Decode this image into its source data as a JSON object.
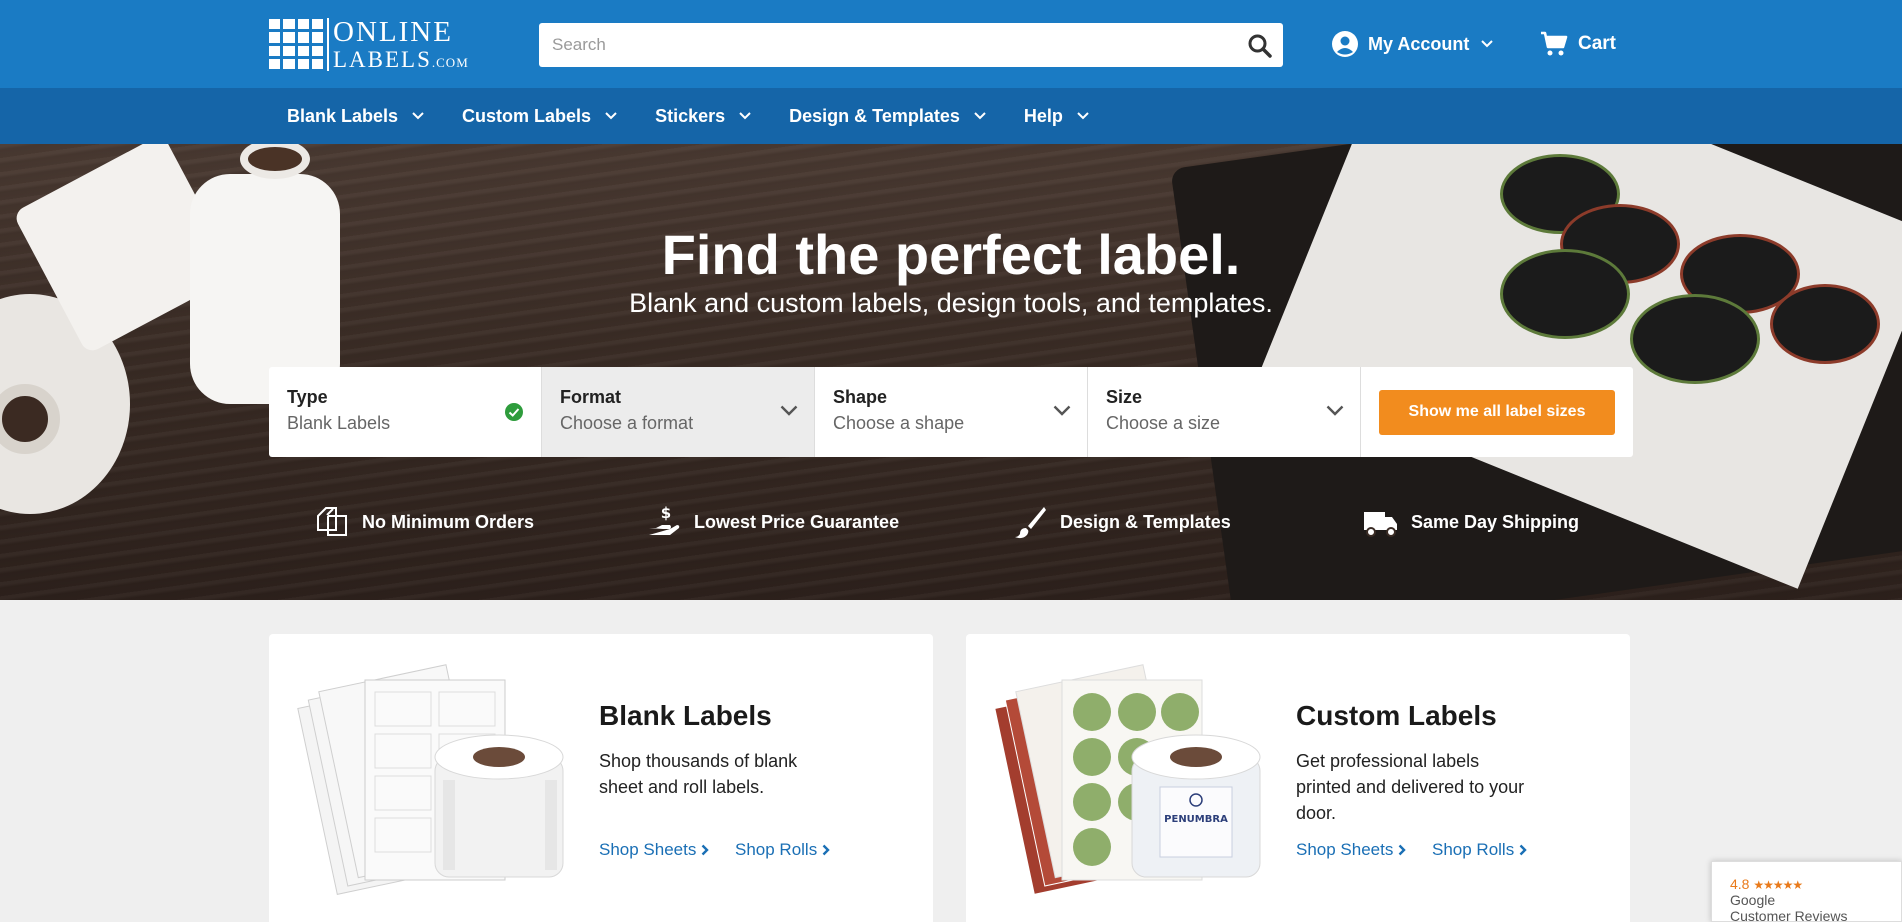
{
  "header": {
    "logo": {
      "line1": "ONLINE",
      "line2": "LABELS",
      "suffix": ".COM"
    },
    "search": {
      "placeholder": "Search",
      "value": ""
    },
    "account_label": "My Account",
    "cart_label": "Cart"
  },
  "nav": {
    "items": [
      {
        "label": "Blank Labels"
      },
      {
        "label": "Custom Labels"
      },
      {
        "label": "Stickers"
      },
      {
        "label": "Design & Templates"
      },
      {
        "label": "Help"
      }
    ]
  },
  "hero": {
    "title": "Find the perfect label.",
    "subtitle": "Blank and custom labels, design tools, and templates.",
    "finder": {
      "type": {
        "label": "Type",
        "value": "Blank Labels"
      },
      "format": {
        "label": "Format",
        "value": "Choose a format"
      },
      "shape": {
        "label": "Shape",
        "value": "Choose a shape"
      },
      "size": {
        "label": "Size",
        "value": "Choose a size"
      },
      "button": "Show me all label sizes"
    },
    "features": [
      {
        "label": "No Minimum Orders",
        "icon": "copy-pages-icon"
      },
      {
        "label": "Lowest Price Guarantee",
        "icon": "hand-dollar-icon"
      },
      {
        "label": "Design & Templates",
        "icon": "paintbrush-icon"
      },
      {
        "label": "Same Day Shipping",
        "icon": "truck-icon"
      }
    ]
  },
  "cards": {
    "blank": {
      "title": "Blank Labels",
      "description": "Shop thousands of blank sheet and roll labels.",
      "link_sheets": "Shop Sheets",
      "link_rolls": "Shop Rolls"
    },
    "custom": {
      "title": "Custom Labels",
      "description": "Get professional labels printed and delivered to your door.",
      "link_sheets": "Shop Sheets",
      "link_rolls": "Shop Rolls",
      "sample_text": "PENUMBRA"
    }
  },
  "reviews_badge": {
    "rating": "4.8",
    "stars": "★★★★★",
    "line1": "Google",
    "line2": "Customer Reviews"
  },
  "colors": {
    "header_blue": "#1a7bc4",
    "nav_blue": "#1565a8",
    "accent_orange": "#f28c1e",
    "link_blue": "#1a6fb5",
    "check_green": "#2e9c3c"
  }
}
